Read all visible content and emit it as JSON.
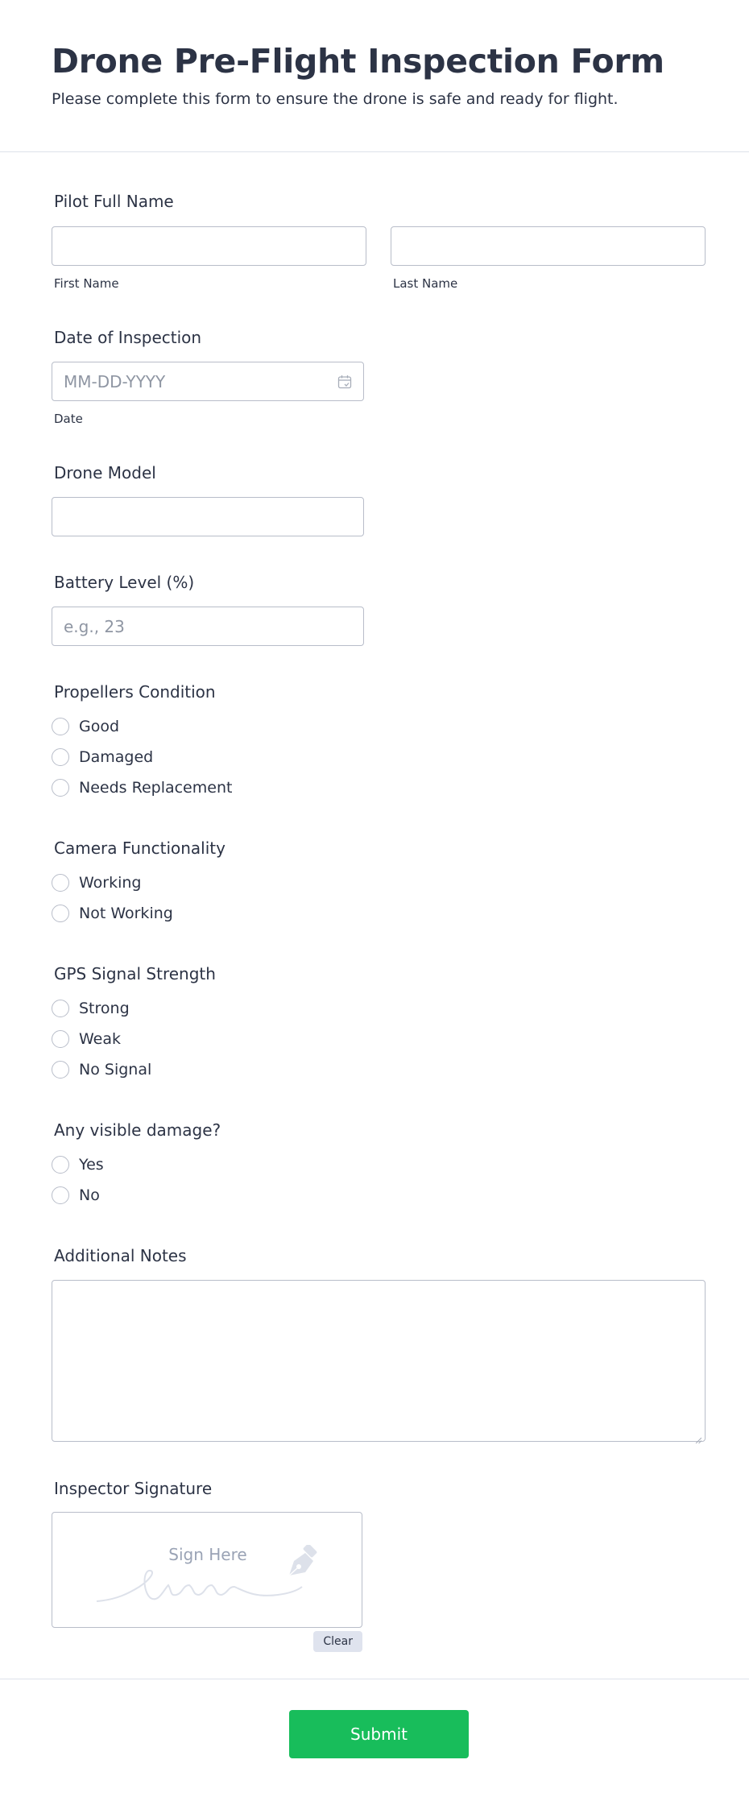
{
  "header": {
    "title": "Drone Pre-Flight Inspection Form",
    "subtitle": "Please complete this form to ensure the drone is safe and ready for flight."
  },
  "pilot_name": {
    "label": "Pilot Full Name",
    "first_sublabel": "First Name",
    "last_sublabel": "Last Name",
    "first_value": "",
    "last_value": ""
  },
  "inspection_date": {
    "label": "Date of Inspection",
    "placeholder": "MM-DD-YYYY",
    "sublabel": "Date",
    "icon": "calendar-icon"
  },
  "drone_model": {
    "label": "Drone Model",
    "value": ""
  },
  "battery_level": {
    "label": "Battery Level (%)",
    "placeholder": "e.g., 23"
  },
  "propellers": {
    "label": "Propellers Condition",
    "options": [
      "Good",
      "Damaged",
      "Needs Replacement"
    ]
  },
  "camera": {
    "label": "Camera Functionality",
    "options": [
      "Working",
      "Not Working"
    ]
  },
  "gps": {
    "label": "GPS Signal Strength",
    "options": [
      "Strong",
      "Weak",
      "No Signal"
    ]
  },
  "damage": {
    "label": "Any visible damage?",
    "options": [
      "Yes",
      "No"
    ]
  },
  "notes": {
    "label": "Additional Notes",
    "value": ""
  },
  "signature": {
    "label": "Inspector Signature",
    "placeholder": "Sign Here",
    "clear_label": "Clear",
    "icon": "pen-nib-icon"
  },
  "footer": {
    "submit_label": "Submit"
  },
  "colors": {
    "text": "#2c3345",
    "border": "#b8bdc9",
    "submit": "#18bd5b",
    "clear_bg": "#dfe3ee"
  }
}
